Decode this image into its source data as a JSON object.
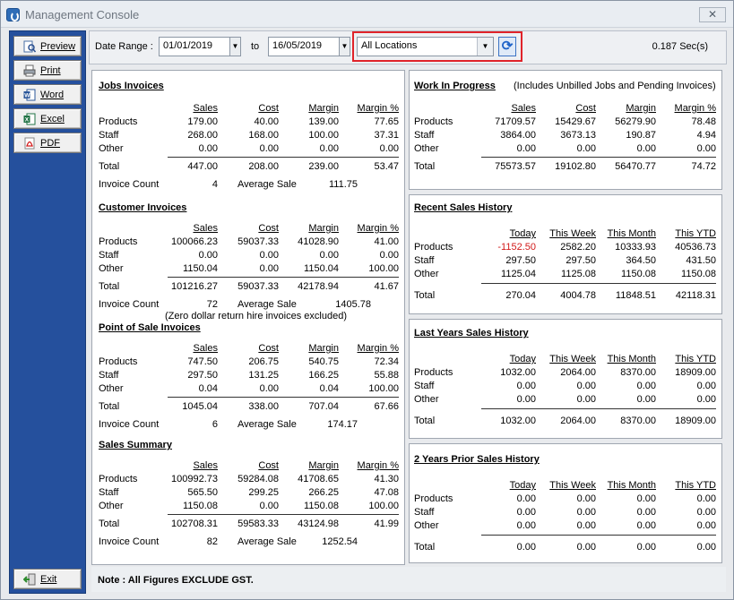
{
  "window": {
    "title": "Management Console",
    "close_glyph": "✕"
  },
  "sidebar": {
    "preview": {
      "label": "Preview",
      "icon": "preview-icon"
    },
    "print": {
      "label": "Print",
      "icon": "printer-icon"
    },
    "word": {
      "label": "Word",
      "icon": "word-icon"
    },
    "excel": {
      "label": "Excel",
      "icon": "excel-icon"
    },
    "pdf": {
      "label": "PDF",
      "icon": "pdf-icon"
    },
    "exit": {
      "label": "Exit",
      "icon": "exit-icon"
    }
  },
  "toolbar": {
    "date_range_label": "Date Range :",
    "from_date": "01/01/2019",
    "to_label": "to",
    "to_date": "16/05/2019",
    "location": "All Locations",
    "timing": "0.187 Sec(s)",
    "highlight_color": "#e0232a"
  },
  "jobs": {
    "title": "Jobs Invoices",
    "cols": [
      "Sales",
      "Cost",
      "Margin",
      "Margin %"
    ],
    "rows": [
      {
        "label": "Products",
        "v": [
          "179.00",
          "40.00",
          "139.00",
          "77.65"
        ]
      },
      {
        "label": "Staff",
        "v": [
          "268.00",
          "168.00",
          "100.00",
          "37.31"
        ]
      },
      {
        "label": "Other",
        "v": [
          "0.00",
          "0.00",
          "0.00",
          "0.00"
        ]
      }
    ],
    "total": {
      "label": "Total",
      "v": [
        "447.00",
        "208.00",
        "239.00",
        "53.47"
      ]
    },
    "count_label": "Invoice Count",
    "count": "4",
    "avg_label": "Average Sale",
    "avg": "111.75"
  },
  "customer": {
    "title": "Customer Invoices",
    "cols": [
      "Sales",
      "Cost",
      "Margin",
      "Margin %"
    ],
    "rows": [
      {
        "label": "Products",
        "v": [
          "100066.23",
          "59037.33",
          "41028.90",
          "41.00"
        ]
      },
      {
        "label": "Staff",
        "v": [
          "0.00",
          "0.00",
          "0.00",
          "0.00"
        ]
      },
      {
        "label": "Other",
        "v": [
          "1150.04",
          "0.00",
          "1150.04",
          "100.00"
        ]
      }
    ],
    "total": {
      "label": "Total",
      "v": [
        "101216.27",
        "59037.33",
        "42178.94",
        "41.67"
      ]
    },
    "count_label": "Invoice Count",
    "count": "72",
    "avg_label": "Average Sale",
    "avg": "1405.78",
    "note": "(Zero dollar return hire invoices excluded)"
  },
  "pos": {
    "title": "Point of Sale Invoices",
    "cols": [
      "Sales",
      "Cost",
      "Margin",
      "Margin %"
    ],
    "rows": [
      {
        "label": "Products",
        "v": [
          "747.50",
          "206.75",
          "540.75",
          "72.34"
        ]
      },
      {
        "label": "Staff",
        "v": [
          "297.50",
          "131.25",
          "166.25",
          "55.88"
        ]
      },
      {
        "label": "Other",
        "v": [
          "0.04",
          "0.00",
          "0.04",
          "100.00"
        ]
      }
    ],
    "total": {
      "label": "Total",
      "v": [
        "1045.04",
        "338.00",
        "707.04",
        "67.66"
      ]
    },
    "count_label": "Invoice Count",
    "count": "6",
    "avg_label": "Average Sale",
    "avg": "174.17"
  },
  "summary": {
    "title": "Sales Summary",
    "cols": [
      "Sales",
      "Cost",
      "Margin",
      "Margin %"
    ],
    "rows": [
      {
        "label": "Products",
        "v": [
          "100992.73",
          "59284.08",
          "41708.65",
          "41.30"
        ]
      },
      {
        "label": "Staff",
        "v": [
          "565.50",
          "299.25",
          "266.25",
          "47.08"
        ]
      },
      {
        "label": "Other",
        "v": [
          "1150.08",
          "0.00",
          "1150.08",
          "100.00"
        ]
      }
    ],
    "total": {
      "label": "Total",
      "v": [
        "102708.31",
        "59583.33",
        "43124.98",
        "41.99"
      ]
    },
    "count_label": "Invoice Count",
    "count": "82",
    "avg_label": "Average Sale",
    "avg": "1252.54"
  },
  "wip": {
    "title": "Work In Progress",
    "subtitle": "(Includes Unbilled Jobs and Pending Invoices)",
    "cols": [
      "Sales",
      "Cost",
      "Margin",
      "Margin %"
    ],
    "rows": [
      {
        "label": "Products",
        "v": [
          "71709.57",
          "15429.67",
          "56279.90",
          "78.48"
        ]
      },
      {
        "label": "Staff",
        "v": [
          "3864.00",
          "3673.13",
          "190.87",
          "4.94"
        ]
      },
      {
        "label": "Other",
        "v": [
          "0.00",
          "0.00",
          "0.00",
          "0.00"
        ]
      }
    ],
    "total": {
      "label": "Total",
      "v": [
        "75573.57",
        "19102.80",
        "56470.77",
        "74.72"
      ]
    }
  },
  "recent": {
    "title": "Recent Sales History",
    "cols": [
      "Today",
      "This Week",
      "This Month",
      "This YTD"
    ],
    "rows": [
      {
        "label": "Products",
        "v": [
          "-1152.50",
          "2582.20",
          "10333.93",
          "40536.73"
        ]
      },
      {
        "label": "Staff",
        "v": [
          "297.50",
          "297.50",
          "364.50",
          "431.50"
        ]
      },
      {
        "label": "Other",
        "v": [
          "1125.04",
          "1125.08",
          "1150.08",
          "1150.08"
        ]
      }
    ],
    "total": {
      "label": "Total",
      "v": [
        "270.04",
        "4004.78",
        "11848.51",
        "42118.31"
      ]
    },
    "negative_color": "#d21a1a"
  },
  "lastyear": {
    "title": "Last Years Sales History",
    "cols": [
      "Today",
      "This Week",
      "This Month",
      "This YTD"
    ],
    "rows": [
      {
        "label": "Products",
        "v": [
          "1032.00",
          "2064.00",
          "8370.00",
          "18909.00"
        ]
      },
      {
        "label": "Staff",
        "v": [
          "0.00",
          "0.00",
          "0.00",
          "0.00"
        ]
      },
      {
        "label": "Other",
        "v": [
          "0.00",
          "0.00",
          "0.00",
          "0.00"
        ]
      }
    ],
    "total": {
      "label": "Total",
      "v": [
        "1032.00",
        "2064.00",
        "8370.00",
        "18909.00"
      ]
    }
  },
  "twoyears": {
    "title": "2 Years Prior Sales History",
    "cols": [
      "Today",
      "This Week",
      "This Month",
      "This YTD"
    ],
    "rows": [
      {
        "label": "Products",
        "v": [
          "0.00",
          "0.00",
          "0.00",
          "0.00"
        ]
      },
      {
        "label": "Staff",
        "v": [
          "0.00",
          "0.00",
          "0.00",
          "0.00"
        ]
      },
      {
        "label": "Other",
        "v": [
          "0.00",
          "0.00",
          "0.00",
          "0.00"
        ]
      }
    ],
    "total": {
      "label": "Total",
      "v": [
        "0.00",
        "0.00",
        "0.00",
        "0.00"
      ]
    }
  },
  "footer": {
    "note": "Note : All Figures EXCLUDE GST."
  }
}
